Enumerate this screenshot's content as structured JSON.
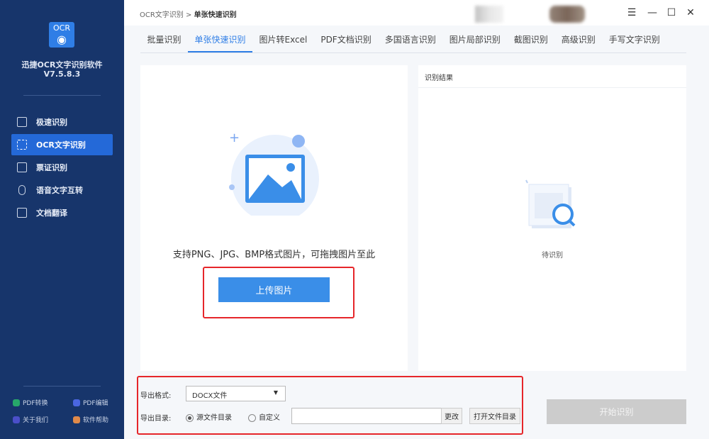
{
  "app": {
    "logo_text": "OCR",
    "name": "迅捷OCR文字识别软件",
    "version": "V7.5.8.3"
  },
  "sidebar": {
    "items": [
      {
        "label": "极速识别"
      },
      {
        "label": "OCR文字识别"
      },
      {
        "label": "票证识别"
      },
      {
        "label": "语音文字互转"
      },
      {
        "label": "文档翻译"
      }
    ],
    "footer": [
      {
        "label": "PDF转换",
        "color": "#27a86a"
      },
      {
        "label": "PDF编辑",
        "color": "#4a66e0"
      },
      {
        "label": "关于我们",
        "color": "#4b4fc9"
      },
      {
        "label": "软件帮助",
        "color": "#e08a4a"
      }
    ]
  },
  "breadcrumb": {
    "parent": "OCR文字识别",
    "sep": ">",
    "current": "单张快速识别"
  },
  "window": {
    "menu": "☰",
    "minimize": "—",
    "maximize": "☐",
    "close": "✕"
  },
  "tabs": [
    {
      "label": "批量识别"
    },
    {
      "label": "单张快速识别"
    },
    {
      "label": "图片转Excel"
    },
    {
      "label": "PDF文档识别"
    },
    {
      "label": "多国语言识别"
    },
    {
      "label": "图片局部识别"
    },
    {
      "label": "截图识别"
    },
    {
      "label": "高级识别"
    },
    {
      "label": "手写文字识别"
    }
  ],
  "upload": {
    "hint": "支持PNG、JPG、BMP格式图片，可拖拽图片至此",
    "button": "上传图片"
  },
  "result": {
    "title": "识别结果",
    "status": "待识别"
  },
  "export": {
    "format_label": "导出格式:",
    "format_value": "DOCX文件",
    "dir_label": "导出目录:",
    "radio_source": "源文件目录",
    "radio_custom": "自定义",
    "path_value": "",
    "change": "更改",
    "open_dir": "打开文件目录"
  },
  "start_button": "开始识别"
}
